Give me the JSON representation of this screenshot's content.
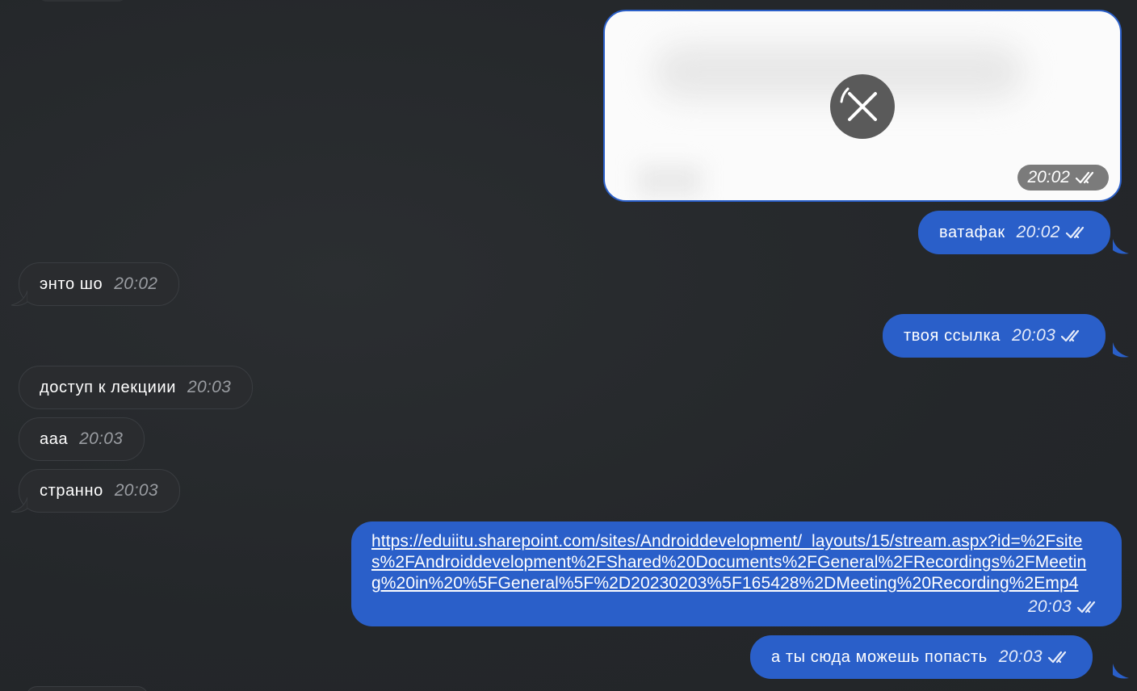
{
  "colors": {
    "background": "#25282b",
    "incoming_bubble": "#2a2c2f",
    "outgoing_bubble": "#2a5fc9",
    "media_time_bg": "#7b7b7b"
  },
  "messages": [
    {
      "direction": "out",
      "type": "media",
      "status_icon": "close-icon",
      "time": "20:02",
      "read_icon": "double-check-icon"
    },
    {
      "direction": "out",
      "text": "ватафак",
      "time": "20:02",
      "read_icon": "double-check-icon"
    },
    {
      "direction": "in",
      "text": "энто шо",
      "time": "20:02"
    },
    {
      "direction": "out",
      "text": "твоя ссылка",
      "time": "20:03",
      "read_icon": "double-check-icon"
    },
    {
      "direction": "in",
      "text": "доступ к лекциии",
      "time": "20:03"
    },
    {
      "direction": "in",
      "text": "ааа",
      "time": "20:03"
    },
    {
      "direction": "in",
      "text": "странно",
      "time": "20:03"
    },
    {
      "direction": "out",
      "type": "link",
      "text": "https://eduiitu.sharepoint.com/sites/Androiddevelopment/_layouts/15/stream.aspx?id=%2Fsites%2FAndroiddevelopment%2FShared%20Documents%2FGeneral%2FRecordings%2FMeeting%20in%20%5FGeneral%5F%2D20230203%5F165428%2DMeeting%20Recording%2Emp4",
      "time": "20:03",
      "read_icon": "double-check-icon"
    },
    {
      "direction": "out",
      "text": "а ты сюда можешь попасть",
      "time": "20:03",
      "read_icon": "double-check-icon"
    }
  ]
}
